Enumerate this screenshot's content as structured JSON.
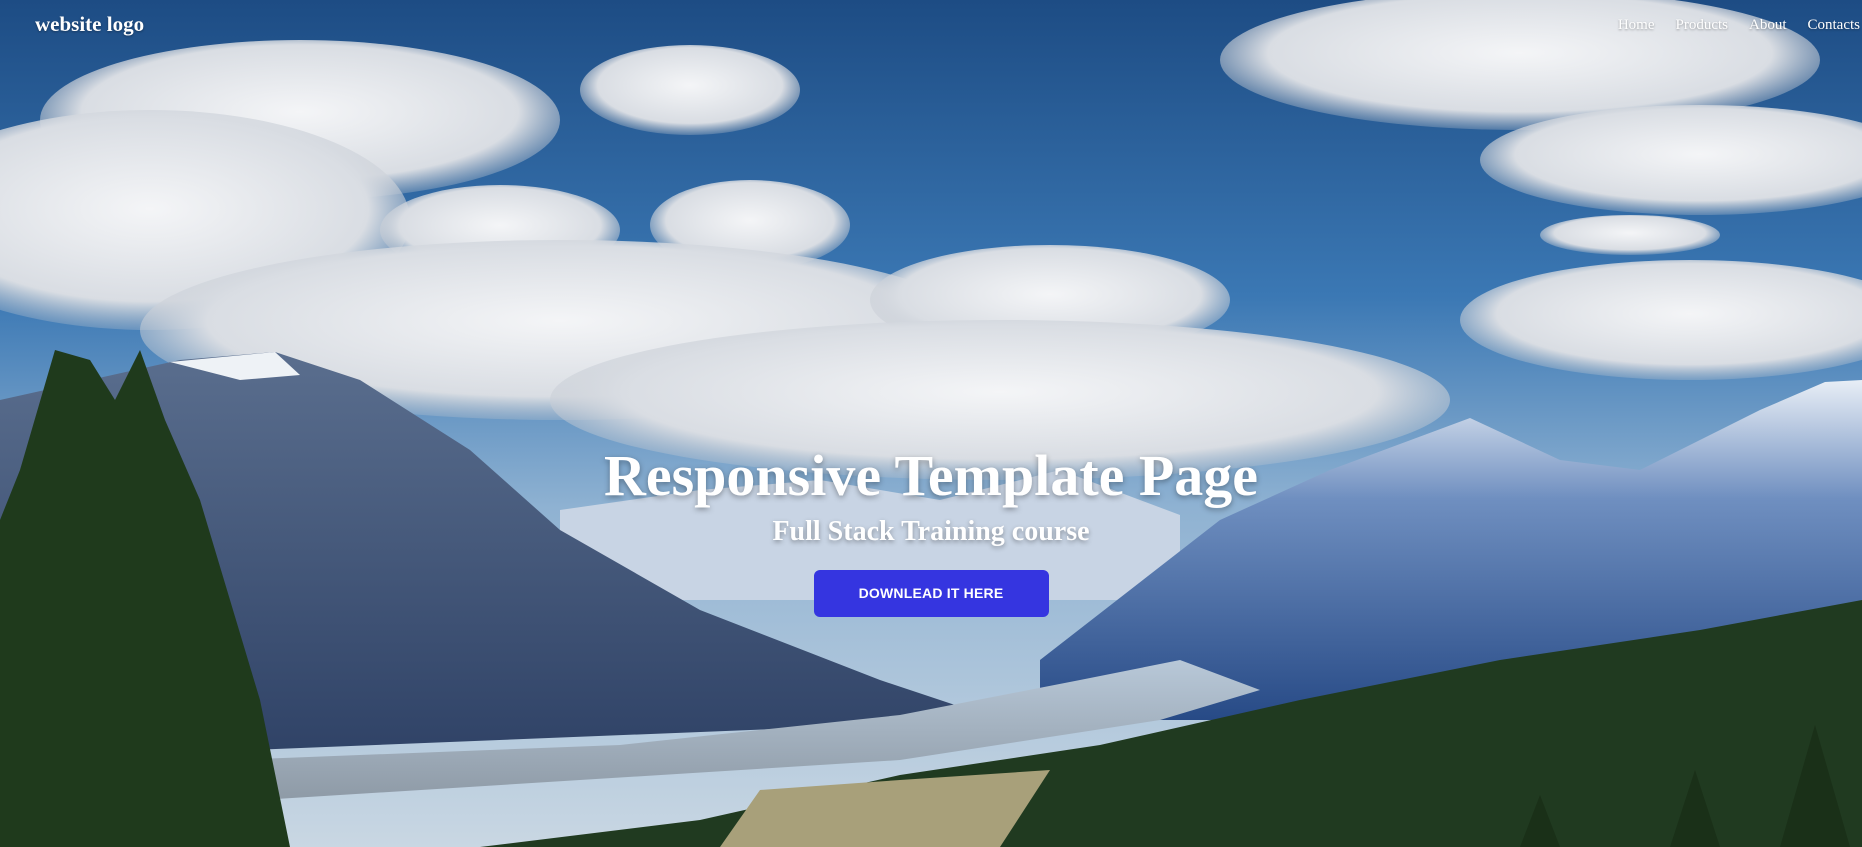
{
  "navbar": {
    "logo": "website logo",
    "links": [
      "Home",
      "Products",
      "About",
      "Contacts"
    ]
  },
  "hero": {
    "title": "Responsive Template Page",
    "subtitle": "Full Stack Training course",
    "cta_label": "DOWNLEAD IT HERE",
    "background_image": "mountain-landscape"
  },
  "colors": {
    "cta_background": "#3535e0",
    "text": "#ffffff",
    "sky": "#2d6aa6"
  }
}
